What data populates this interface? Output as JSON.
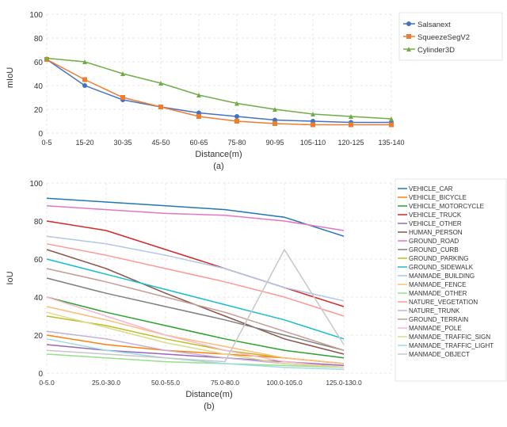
{
  "chart_a": {
    "title": "(a)",
    "x_label": "Distance(m)",
    "y_label": "mIoU",
    "x_ticks": [
      "0-5",
      "15-20",
      "30-35",
      "45-50",
      "60-65",
      "75-80",
      "90-95",
      "105-110",
      "120-125",
      "135-140"
    ],
    "y_ticks": [
      0,
      20,
      40,
      60,
      80,
      100
    ],
    "legend": [
      {
        "label": "Salsanext",
        "color": "#4472C4"
      },
      {
        "label": "SqueezeSegV2",
        "color": "#ED7D31"
      },
      {
        "label": "Cylinder3D",
        "color": "#70AD47"
      }
    ],
    "series": {
      "salsanext": [
        62,
        40,
        28,
        22,
        17,
        14,
        11,
        10,
        9,
        9
      ],
      "squeezesegv2": [
        62,
        45,
        30,
        22,
        14,
        10,
        8,
        7,
        7,
        7
      ],
      "cylinder3d": [
        63,
        60,
        50,
        42,
        32,
        25,
        20,
        16,
        14,
        12
      ]
    }
  },
  "chart_b": {
    "title": "(b)",
    "x_label": "Distance(m)",
    "y_label": "IoU",
    "x_ticks": [
      "0-5.0",
      "25.0-30.0",
      "50.0-55.0",
      "75.0-80.0",
      "100.0-105.0",
      "125.0-130.0"
    ],
    "y_ticks": [
      0,
      20,
      40,
      60,
      80,
      100
    ],
    "legend": [
      {
        "label": "VEHICLE_CAR",
        "color": "#1f77b4"
      },
      {
        "label": "VEHICLE_BICYCLE",
        "color": "#ff7f0e"
      },
      {
        "label": "VEHICLE_MOTORCYCLE",
        "color": "#2ca02c"
      },
      {
        "label": "VEHICLE_TRUCK",
        "color": "#d62728"
      },
      {
        "label": "VEHICLE_OTHER",
        "color": "#9467bd"
      },
      {
        "label": "HUMAN_PERSON",
        "color": "#8c564b"
      },
      {
        "label": "GROUND_ROAD",
        "color": "#e377c2"
      },
      {
        "label": "GROUND_CURB",
        "color": "#7f7f7f"
      },
      {
        "label": "GROUND_PARKING",
        "color": "#bcbd22"
      },
      {
        "label": "GROUND_SIDEWALK",
        "color": "#17becf"
      },
      {
        "label": "MANMADE_BUILDING",
        "color": "#aec7e8"
      },
      {
        "label": "MANMADE_FENCE",
        "color": "#ffbb78"
      },
      {
        "label": "MANMADE_OTHER",
        "color": "#98df8a"
      },
      {
        "label": "NATURE_VEGETATION",
        "color": "#ff9896"
      },
      {
        "label": "NATURE_TRUNK",
        "color": "#c5b0d5"
      },
      {
        "label": "GROUND_TERRAIN",
        "color": "#c49c94"
      },
      {
        "label": "MANMADE_POLE",
        "color": "#f7b6d2"
      },
      {
        "label": "MANMADE_TRAFFIC_SIGN",
        "color": "#dbdb8d"
      },
      {
        "label": "MANMADE_TRAFFIC_LIGHT",
        "color": "#9edae5"
      },
      {
        "label": "MANMADE_OBJECT",
        "color": "#c7c7c7"
      }
    ]
  }
}
